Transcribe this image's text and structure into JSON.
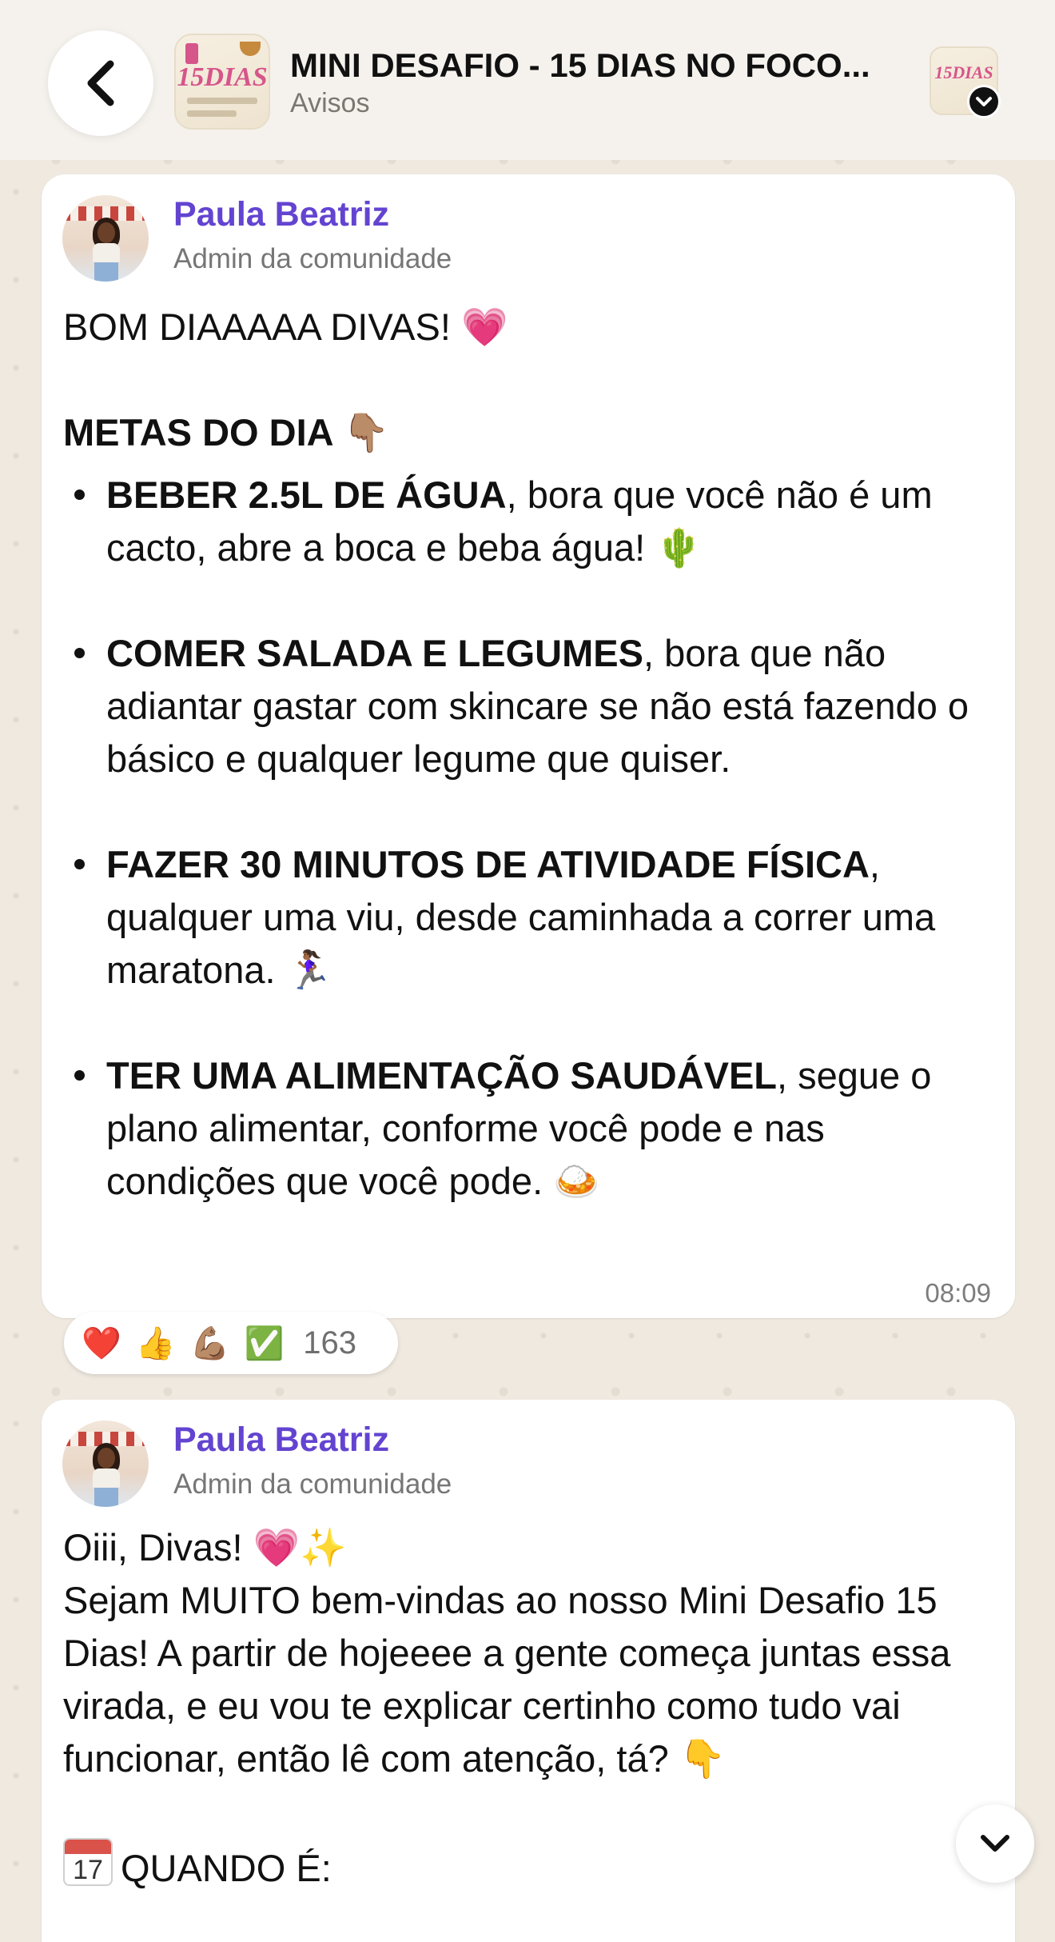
{
  "header": {
    "title": "MINI DESAFIO - 15 DIAS NO FOCO...",
    "subtitle": "Avisos",
    "thumb_text": "15DIAS"
  },
  "messages": [
    {
      "sender": "Paula Beatriz",
      "role": "Admin da comunidade",
      "greeting": "BOM DIAAAAA DIVAS! 💗",
      "heading": "METAS DO DIA 👇🏽",
      "bullets": [
        {
          "bold": "BEBER 2.5L DE ÁGUA",
          "text": ", bora que você não é um cacto, abre a boca e beba água! 🌵"
        },
        {
          "bold": "COMER SALADA E LEGUMES",
          "text": ", bora que não adiantar gastar com skincare se não está fazendo o básico e qualquer legume que quiser."
        },
        {
          "bold": "FAZER 30 MINUTOS DE ATIVIDADE FÍSICA",
          "text": ", qualquer uma viu, desde caminhada a correr uma maratona. 🏃🏾‍♀️"
        },
        {
          "bold": "TER UMA ALIMENTAÇÃO SAUDÁVEL",
          "text": ", segue o plano alimentar, conforme você pode e nas condições que você pode. 🍛"
        }
      ],
      "time": "08:09",
      "reactions": {
        "emojis": [
          "❤️",
          "👍",
          "💪🏽",
          "✅"
        ],
        "count": "163"
      }
    },
    {
      "sender": "Paula Beatriz",
      "role": "Admin da comunidade",
      "line1": "Oiii, Divas! 💗✨",
      "paragraph": "Sejam MUITO bem-vindas ao nosso Mini Desafio 15 Dias! A partir de hojeeee a gente começa juntas essa virada, e eu vou te explicar certinho como tudo vai funcionar, então lê com atenção, tá? 👇",
      "calendar": {
        "month": "JUL",
        "day": "17"
      },
      "section": "QUANDO É:"
    }
  ],
  "colors": {
    "sender": "#6344d1",
    "background": "#efe9e0",
    "bubble": "#ffffff"
  },
  "icons": [
    "back-arrow-icon",
    "chevron-down-icon",
    "calendar-icon"
  ]
}
